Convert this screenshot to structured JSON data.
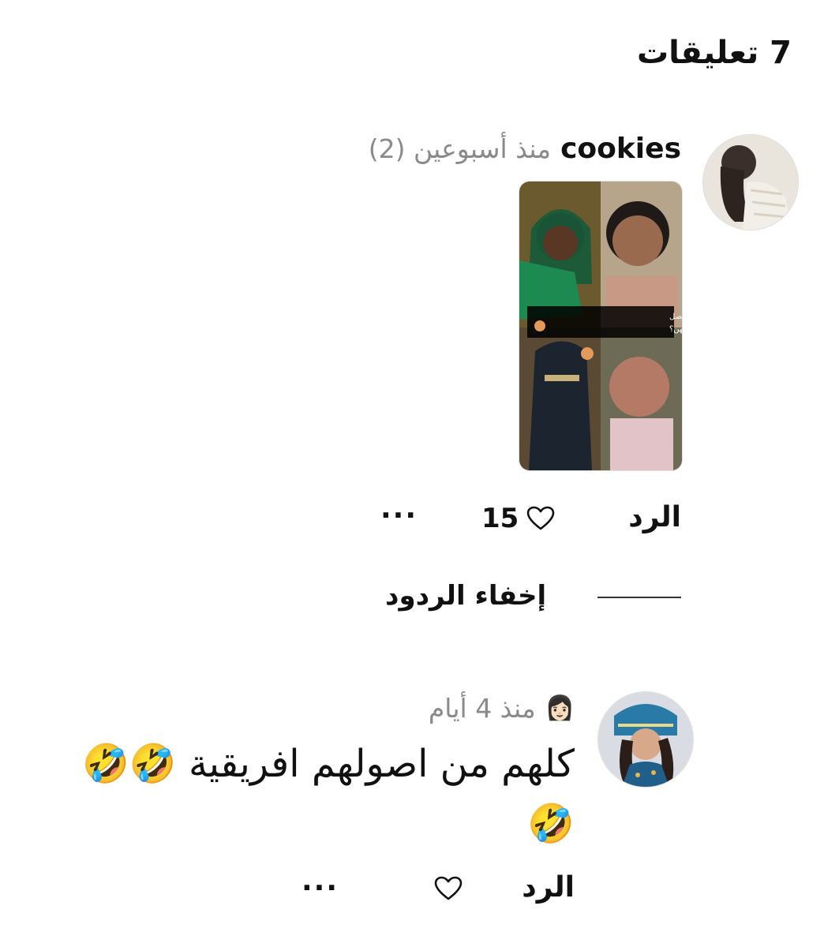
{
  "header": {
    "title": "7 تعليقات"
  },
  "comments": [
    {
      "username": "cookies",
      "timestamp": "منذ أسبوعين (2)",
      "attachment": {
        "caption_line1": "تحسون رائحة السعوديات بصل",
        "caption_line2": "لمجرد النظر إلى وجوههن؟"
      },
      "actions": {
        "reply_label": "الرد",
        "like_count": "15",
        "more_label": "···"
      },
      "replies_toggle": "إخفاء الردود"
    },
    {
      "username_emoji": "👩🏻",
      "timestamp": "منذ 4 أيام",
      "text": "كلهم من اصولهم افريقية 🤣🤣🤣",
      "actions": {
        "reply_label": "الرد",
        "like_count": "",
        "more_label": "···"
      }
    }
  ]
}
